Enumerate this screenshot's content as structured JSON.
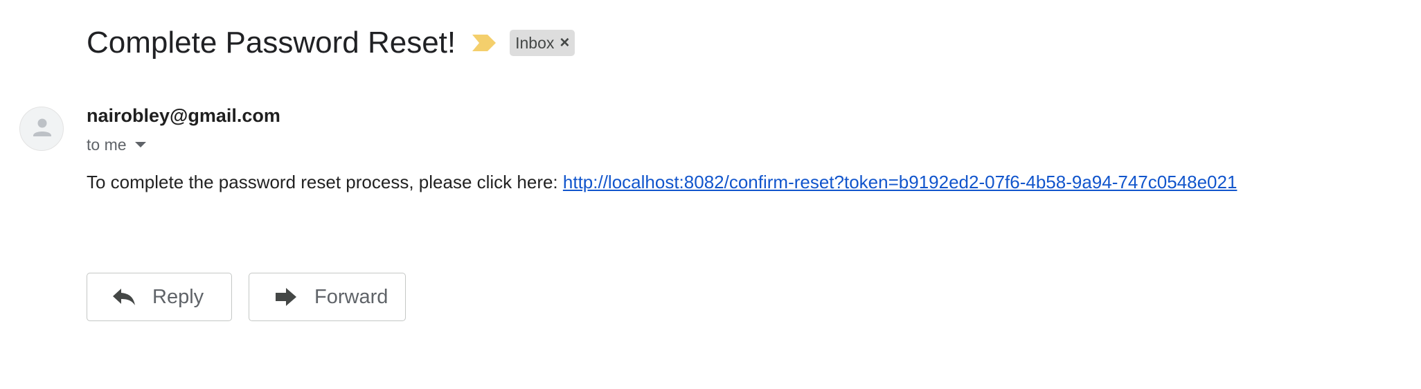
{
  "message": {
    "subject": "Complete Password Reset!",
    "label": "Inbox",
    "label_remove_icon": "close-icon",
    "importance_icon": "importance-marker-icon",
    "sender": "nairobley@gmail.com",
    "recipient": "to me",
    "body_prefix": "To complete the password reset process, please click here: ",
    "link_text": "http://localhost:8082/confirm-reset?token=b9192ed2-07f6-4b58-9a94-747c0548e021"
  },
  "actions": {
    "reply_label": "Reply",
    "forward_label": "Forward",
    "reply_icon": "reply-icon",
    "forward_icon": "forward-icon"
  },
  "colors": {
    "importance": "#f4cf6c",
    "link": "#1155cc",
    "chip_bg": "#dddddd",
    "avatar_bg": "#f1f3f4"
  }
}
